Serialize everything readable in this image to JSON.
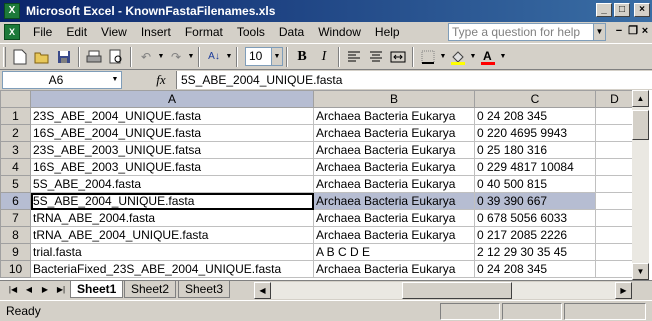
{
  "window": {
    "title": "Microsoft Excel - KnownFastaFilenames.xls",
    "app_icon": "excel-icon"
  },
  "menu": [
    "File",
    "Edit",
    "View",
    "Insert",
    "Format",
    "Tools",
    "Data",
    "Window",
    "Help"
  ],
  "help_box": {
    "placeholder": "Type a question for help"
  },
  "toolbar": {
    "font_size": "10",
    "bold": "B",
    "italic": "I"
  },
  "formula_bar": {
    "name_box": "A6",
    "fx": "fx",
    "content": "5S_ABE_2004_UNIQUE.fasta"
  },
  "columns": [
    "A",
    "B",
    "C",
    "D"
  ],
  "rows": [
    {
      "num": "1",
      "a": "23S_ABE_2004_UNIQUE.fasta",
      "b": "Archaea Bacteria Eukarya",
      "c": "0 24 208 345"
    },
    {
      "num": "2",
      "a": "16S_ABE_2004_UNIQUE.fasta",
      "b": "Archaea Bacteria Eukarya",
      "c": "0 220 4695 9943"
    },
    {
      "num": "3",
      "a": "23S_ABE_2003_UNIQUE.fatsa",
      "b": "Archaea Bacteria Eukarya",
      "c": "0 25 180 316"
    },
    {
      "num": "4",
      "a": "16S_ABE_2003_UNIQUE.fasta",
      "b": "Archaea Bacteria Eukarya",
      "c": "0 229 4817 10084"
    },
    {
      "num": "5",
      "a": "5S_ABE_2004.fasta",
      "b": "Archaea Bacteria Eukarya",
      "c": "0 40 500 815"
    },
    {
      "num": "6",
      "a": "5S_ABE_2004_UNIQUE.fasta",
      "b": "Archaea Bacteria Eukarya",
      "c": "0 39 390 667"
    },
    {
      "num": "7",
      "a": "tRNA_ABE_2004.fasta",
      "b": "Archaea Bacteria Eukarya",
      "c": "0 678 5056 6033"
    },
    {
      "num": "8",
      "a": "tRNA_ABE_2004_UNIQUE.fasta",
      "b": "Archaea Bacteria Eukarya",
      "c": "0 217 2085 2226"
    },
    {
      "num": "9",
      "a": "trial.fasta",
      "b": "A B C D E",
      "c": "2 12 29 30 35 45"
    },
    {
      "num": "10",
      "a": "BacteriaFixed_23S_ABE_2004_UNIQUE.fasta",
      "b": "Archaea Bacteria Eukarya",
      "c": "0 24 208 345"
    }
  ],
  "selected_row": "6",
  "sheet_tabs": [
    "Sheet1",
    "Sheet2",
    "Sheet3"
  ],
  "active_sheet": "Sheet1",
  "status": "Ready"
}
